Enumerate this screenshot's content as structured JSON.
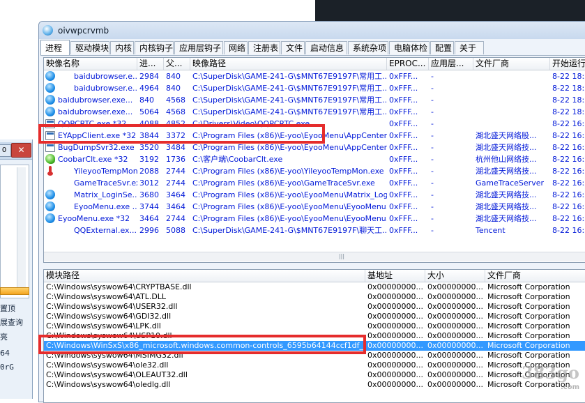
{
  "window": {
    "title": "oivwpcrvmb"
  },
  "tabs": [
    "进程",
    "驱动模块",
    "内核",
    "内核钩子",
    "应用层钩子",
    "网络",
    "注册表",
    "文件",
    "启动信息",
    "系统杂项",
    "电脑体检",
    "配置",
    "关于"
  ],
  "process_table": {
    "columns": [
      "映像名称",
      "进...",
      "父...",
      "映像路径",
      "EPROC...",
      "应用层...",
      "文件厂商",
      "开始运行"
    ],
    "rows": [
      {
        "icon": "browser-icon",
        "name": "baidubrowser.e...",
        "pid": "2984",
        "ppid": "840",
        "path": "C:\\SuperDisk\\GAME-241-G\\$MNT67E9197F\\常用工...",
        "eprocess": "0xFFF...",
        "app": "-",
        "vendor": "",
        "start": "8-22 18:2",
        "indent": true
      },
      {
        "icon": "browser-icon",
        "name": "baidubrowser.e...",
        "pid": "4964",
        "ppid": "840",
        "path": "C:\\SuperDisk\\GAME-241-G\\$MNT67E9197F\\常用工...",
        "eprocess": "0xFFF...",
        "app": "-",
        "vendor": "",
        "start": "8-22 18:2",
        "indent": true
      },
      {
        "icon": "browser-icon",
        "name": "baidubrowser.exe...",
        "pid": "840",
        "ppid": "4568",
        "path": "C:\\SuperDisk\\GAME-241-G\\$MNT67E9197F\\常用工...",
        "eprocess": "0xFFF...",
        "app": "-",
        "vendor": "",
        "start": "8-22 18:2",
        "indent": false
      },
      {
        "icon": "browser-icon",
        "name": "baidubrowser.exe...",
        "pid": "5064",
        "ppid": "4568",
        "path": "C:\\SuperDisk\\GAME-241-G\\$MNT67E9197F\\常用工...",
        "eprocess": "0xFFF...",
        "app": "-",
        "vendor": "",
        "start": "8-22 18:2",
        "indent": false
      },
      {
        "icon": "window-icon",
        "name": "QQPCRTC.exe *32",
        "pid": "4088",
        "ppid": "4852",
        "path": "C:\\Drivers\\Video\\QQPCRTC.exe",
        "eprocess": "0xFFF...",
        "app": "-",
        "vendor": "",
        "start": "8-22 16:3",
        "indent": false
      },
      {
        "icon": "window-icon",
        "name": "EYAppClient.exe *32",
        "pid": "3844",
        "ppid": "3372",
        "path": "C:\\Program Files (x86)\\E-yoo\\EyooMenu\\AppCenter\\...",
        "eprocess": "0xFFF...",
        "app": "-",
        "vendor": "湖北盛天网络股...",
        "start": "8-22 16:2",
        "indent": false
      },
      {
        "icon": "window-icon",
        "name": "BugDumpSvr32.exe",
        "pid": "3520",
        "ppid": "3484",
        "path": "C:\\Program Files (x86)\\E-yoo\\EyooMenu\\AppCenter\\...",
        "eprocess": "0xFFF...",
        "app": "-",
        "vendor": "湖北盛天网络技...",
        "start": "8-22 16:2",
        "indent": false
      },
      {
        "icon": "coobar-icon",
        "name": "CoobarClt.exe *32",
        "pid": "3192",
        "ppid": "1736",
        "path": "C:\\客户端\\CoobarClt.exe",
        "eprocess": "0xFFF...",
        "app": "-",
        "vendor": "杭州他山网络技...",
        "start": "8-22 16:2",
        "indent": false
      },
      {
        "icon": "thermometer-icon",
        "name": "YileyooTempMon....",
        "pid": "2088",
        "ppid": "2744",
        "path": "C:\\Program Files (x86)\\E-yoo\\YileyooTempMon.exe",
        "eprocess": "0xFFF...",
        "app": "-",
        "vendor": "湖北盛天网络技...",
        "start": "8-22 16:2",
        "indent": true
      },
      {
        "icon": "",
        "name": "GameTraceSvr.ex...",
        "pid": "3012",
        "ppid": "2744",
        "path": "C:\\Program Files (x86)\\E-yoo\\GameTraceSvr.exe",
        "eprocess": "0xFFF...",
        "app": "-",
        "vendor": "GameTraceServer",
        "start": "8-22 16:2",
        "indent": true
      },
      {
        "icon": "eyoo-icon",
        "name": "Matrix_LoginSe...",
        "pid": "3680",
        "ppid": "3464",
        "path": "C:\\Program Files (x86)\\E-yoo\\EyooMenu\\Matrix_Logi...",
        "eprocess": "0xFFF...",
        "app": "-",
        "vendor": "湖北盛天网络技...",
        "start": "8-22 16:2",
        "indent": true
      },
      {
        "icon": "eyoo-icon",
        "name": "EyooMenu.exe ...",
        "pid": "3744",
        "ppid": "3464",
        "path": "C:\\Program Files (x86)\\E-yoo\\EyooMenu\\EyooMenu....",
        "eprocess": "0xFFF...",
        "app": "-",
        "vendor": "湖北盛天网络技...",
        "start": "8-22 16:2",
        "indent": true
      },
      {
        "icon": "eyoo-icon",
        "name": "EyooMenu.exe *32",
        "pid": "3464",
        "ppid": "2744",
        "path": "C:\\Program Files (x86)\\E-yoo\\EyooMenu\\EyooMenu....",
        "eprocess": "0xFFF...",
        "app": "-",
        "vendor": "湖北盛天网络技...",
        "start": "8-22 16:2",
        "indent": false
      },
      {
        "icon": "",
        "name": "QQExternal.ex...",
        "pid": "2996",
        "ppid": "5088",
        "path": "C:\\SuperDisk\\GAME-241-G\\$MNT67E9197F\\聊天工...",
        "eprocess": "0xFFF...",
        "app": "-",
        "vendor": "Tencent",
        "start": "8-22 16:3",
        "indent": true
      }
    ]
  },
  "module_table": {
    "columns": [
      "模块路径",
      "基地址",
      "大小",
      "文件厂商"
    ],
    "rows": [
      {
        "path": "C:\\Windows\\syswow64\\CRYPTBASE.dll",
        "base": "0x00000000...",
        "size": "0x00000000...",
        "vendor": "Microsoft Corporation"
      },
      {
        "path": "C:\\Windows\\syswow64\\ATL.DLL",
        "base": "0x00000000...",
        "size": "0x00000000...",
        "vendor": "Microsoft Corporation"
      },
      {
        "path": "C:\\Windows\\syswow64\\USER32.dll",
        "base": "0x00000000...",
        "size": "0x00000000...",
        "vendor": "Microsoft Corporation"
      },
      {
        "path": "C:\\Windows\\syswow64\\GDI32.dll",
        "base": "0x00000000...",
        "size": "0x00000000...",
        "vendor": "Microsoft Corporation"
      },
      {
        "path": "C:\\Windows\\syswow64\\LPK.dll",
        "base": "0x00000000...",
        "size": "0x00000000...",
        "vendor": "Microsoft Corporation"
      },
      {
        "path": "C:\\Windows\\syswow64\\USP10.dll",
        "base": "0x00000000...",
        "size": "0x00000000...",
        "vendor": "Microsoft Corporation"
      },
      {
        "path": "C:\\Windows\\WinSxS\\x86_microsoft.windows.common-controls_6595b64144ccf1df_5.82.76...",
        "base": "0x00000000...",
        "size": "0x00000000...",
        "vendor": "Microsoft Corporation",
        "selected": true
      },
      {
        "path": "C:\\Windows\\syswow64\\MSIMG32.dll",
        "base": "0x00000000...",
        "size": "0x00000000...",
        "vendor": "Microsoft Corporation"
      },
      {
        "path": "C:\\Windows\\syswow64\\ole32.dll",
        "base": "0x00000000...",
        "size": "0x00000000...",
        "vendor": "Microsoft Corporation"
      },
      {
        "path": "C:\\Windows\\syswow64\\OLEAUT32.dll",
        "base": "0x00000000...",
        "size": "0x00000000...",
        "vendor": "Microsoft Corporation"
      },
      {
        "path": "C:\\Windows\\syswow64\\oledlg.dll",
        "base": "0x00000000...",
        "size": "0x00000000...",
        "vendor": "Microsoft Corporation"
      }
    ]
  },
  "left_window": {
    "min_label": "0",
    "close_label": "✕",
    "texts": [
      "置顶",
      "展查询",
      "亮",
      "64",
      "0rG"
    ]
  },
  "watermark": {
    "text": "383go",
    "sub": ".com"
  },
  "colors": {
    "process_text": "#0018d8",
    "highlight": "#e52c2c",
    "selection": "#3399ff"
  }
}
